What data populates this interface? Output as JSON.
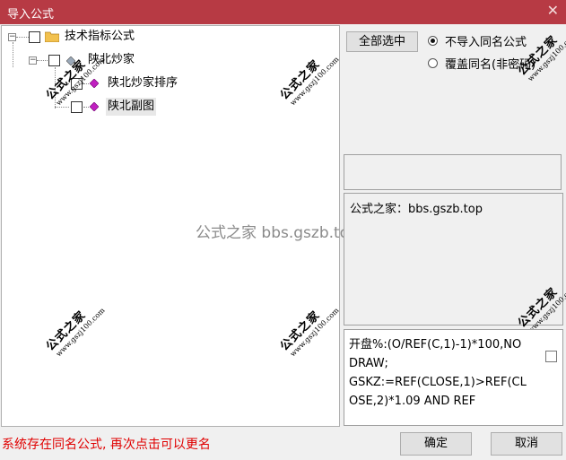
{
  "window": {
    "title": "导入公式",
    "close_glyph": "✕"
  },
  "tree": {
    "root": {
      "label": "技术指标公式"
    },
    "group": {
      "label": "陕北炒家"
    },
    "items": [
      {
        "label": "陕北炒家排序"
      },
      {
        "label": "陕北副图"
      }
    ]
  },
  "buttons": {
    "select_all": "全部选中",
    "ok": "确定",
    "cancel": "取消"
  },
  "options": {
    "no_import_same": "不导入同名公式",
    "overwrite_same": "覆盖同名(非密码)",
    "selected": "no_import_same"
  },
  "info_text": "公式之家：bbs.gszb.top",
  "formula_text": "开盘%:(O/REF(C,1)-1)*100,NODRAW;\nGSKZ:=REF(CLOSE,1)>REF(CLOSE,2)*1.09 AND REF",
  "watermark": {
    "big": "公式之家",
    "small": "www.gszj100.com"
  },
  "center_watermark": "公式之家 bbs.gszb.top",
  "status_text": "系统存在同名公式, 再次点击可以更名",
  "colors": {
    "title_bar": "#b73a44",
    "status_text": "#e00000",
    "folder": "#f2c14e",
    "diamond": "#c020c0"
  }
}
